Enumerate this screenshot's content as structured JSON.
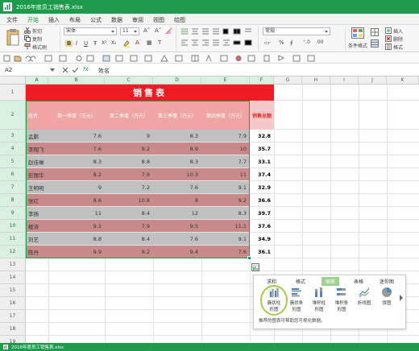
{
  "window": {
    "title": "2016年度员工销售表.xlsx"
  },
  "menu": {
    "items": [
      {
        "label": "文件"
      },
      {
        "label": "开始"
      },
      {
        "label": "插入"
      },
      {
        "label": "布局"
      },
      {
        "label": "公式"
      },
      {
        "label": "数据"
      },
      {
        "label": "审阅"
      },
      {
        "label": "视图"
      },
      {
        "label": "绘图"
      }
    ],
    "active_index": 1
  },
  "ribbon": {
    "clipboard": {
      "cut": "剪切",
      "copy": "复制",
      "paste_format": "格式刷"
    },
    "font": {
      "name": "宋体",
      "size": "11"
    },
    "number_format": "常规",
    "cond_format": "条件格式",
    "insert": "插入",
    "delete": "删除",
    "format": "格式"
  },
  "formula": {
    "cell_ref": "A2",
    "fx": "fx",
    "content": "姓名"
  },
  "columns": [
    "A",
    "B",
    "C",
    "D",
    "E",
    "F",
    "G",
    "H",
    "I",
    "J",
    "K"
  ],
  "rows": [
    "1",
    "2",
    "3",
    "4",
    "5",
    "6",
    "7",
    "8",
    "9",
    "10",
    "11",
    "12",
    "13",
    "14",
    "15",
    "16",
    "17",
    "18",
    "19"
  ],
  "sheet": {
    "title": "销售表",
    "headers": [
      "姓名",
      "第一季度（万元）",
      "第二季度（万元）",
      "第三季度（万元）",
      "第四季度（万元）",
      "销售总额"
    ],
    "data": [
      [
        "孟鹏",
        "7.6",
        "9",
        "8.3",
        "7.9",
        "32.8"
      ],
      [
        "李翔飞",
        "7.6",
        "9.2",
        "8.9",
        "10",
        "35.7"
      ],
      [
        "赵佳琳",
        "8.3",
        "8.8",
        "8.3",
        "7.7",
        "33.1"
      ],
      [
        "彭丽华",
        "8.2",
        "7.9",
        "10.3",
        "11",
        "37.4"
      ],
      [
        "王明明",
        "9",
        "7.2",
        "7.6",
        "9.1",
        "32.9"
      ],
      [
        "张红",
        "8.6",
        "10.8",
        "8",
        "9.2",
        "36.6"
      ],
      [
        "李扬",
        "11",
        "8.4",
        "12",
        "8.3",
        "39.7"
      ],
      [
        "楼涛",
        "9.1",
        "7.9",
        "9.5",
        "11.1",
        "37.6"
      ],
      [
        "刘艺",
        "8.8",
        "8.4",
        "7.6",
        "9.1",
        "34.9"
      ],
      [
        "陈丹",
        "9.9",
        "9.2",
        "9.4",
        "7.6",
        "36.1"
      ]
    ]
  },
  "quick_analysis": {
    "tabs": [
      {
        "label": "求和"
      },
      {
        "label": "格式"
      },
      {
        "label": "图表"
      },
      {
        "label": "表格"
      },
      {
        "label": "迷你图"
      }
    ],
    "active_tab": 2,
    "buttons": [
      {
        "label": "簇状柱形图",
        "icon": "clustered-column-chart-icon"
      },
      {
        "label": "簇状条形图",
        "icon": "clustered-bar-chart-icon"
      },
      {
        "label": "堆积柱形图",
        "icon": "stacked-column-chart-icon"
      },
      {
        "label": "堆积条形图",
        "icon": "stacked-bar-chart-icon"
      },
      {
        "label": "折线图",
        "icon": "line-chart-icon"
      },
      {
        "label": "饼图",
        "icon": "pie-chart-icon"
      }
    ],
    "hint": "推荐的图表可帮助您可视化数据。"
  },
  "status": {
    "text": "2016年度员工销售表.xlsx"
  },
  "colors": {
    "accent": "#1e9a4d",
    "title_red": "#ee1c24",
    "header_pink": "#f0a5a5",
    "row_gray": "#c0c0c0",
    "row_rose": "#c98a8a",
    "total_pink": "#f6c9c9"
  }
}
